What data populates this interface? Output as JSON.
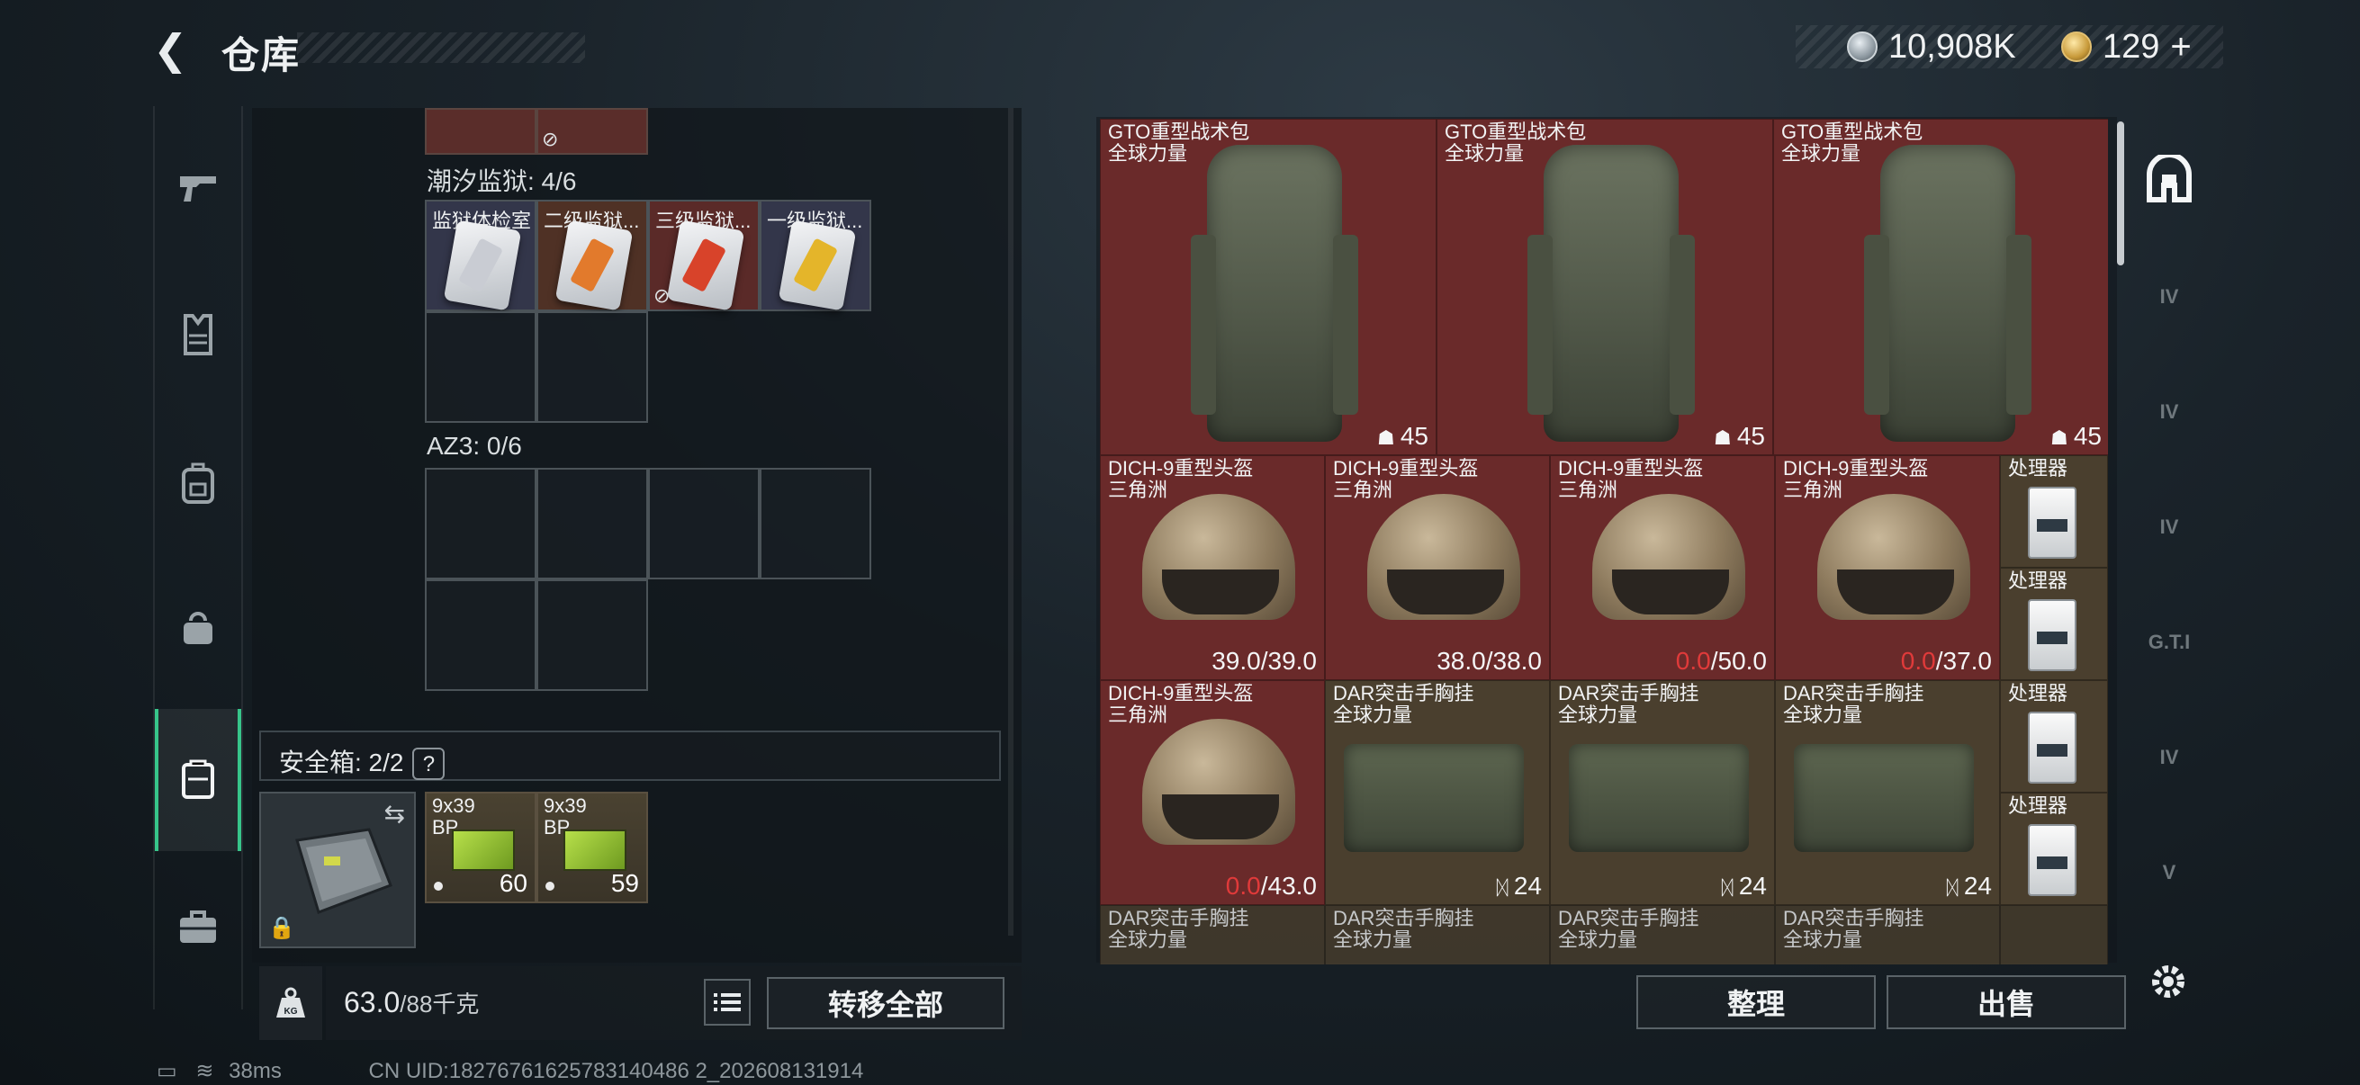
{
  "header": {
    "back_icon": "back-arrow-icon",
    "title": "仓库",
    "currency_silver": "10,908K",
    "currency_gold": "129",
    "add_label": "+"
  },
  "sidebar": {
    "items": [
      {
        "name": "weapon-icon",
        "glyph": "🔫"
      },
      {
        "name": "armor-vest-icon",
        "glyph": "🦺"
      },
      {
        "name": "backpack-icon",
        "glyph": "🎒"
      },
      {
        "name": "bag-icon",
        "glyph": "👜"
      },
      {
        "name": "safe-case-icon",
        "glyph": "🗄"
      },
      {
        "name": "toolbox-icon",
        "glyph": "🧰"
      }
    ],
    "active_index": 4
  },
  "left": {
    "section1_label": "潮汐监狱: 4/6",
    "section1_items": [
      "监狱体检室",
      "二级监狱...",
      "三级监狱...",
      "一级监狱..."
    ],
    "section2_label": "AZ3: 0/6",
    "safe_label": "安全箱: 2/2",
    "safe_help": "?",
    "ammo": [
      {
        "line1": "9x39",
        "line2": "BP",
        "count": "60"
      },
      {
        "line1": "9x39",
        "line2": "BP",
        "count": "59"
      }
    ],
    "weight_current": "63.0",
    "weight_max": "/88千克",
    "kg_icon_label": "KG",
    "transfer_all": "转移全部"
  },
  "grid": {
    "row1": [
      {
        "name": "GTO重型战术包",
        "sub": "全球力量",
        "count": "45"
      },
      {
        "name": "GTO重型战术包",
        "sub": "全球力量",
        "count": "45"
      },
      {
        "name": "GTO重型战术包",
        "sub": "全球力量",
        "count": "45"
      }
    ],
    "helmets": [
      {
        "name": "DICH-9重型头盔",
        "sub": "三角洲",
        "cur": "39.0",
        "max": "/39.0",
        "broken": false
      },
      {
        "name": "DICH-9重型头盔",
        "sub": "三角洲",
        "cur": "38.0",
        "max": "/38.0",
        "broken": false
      },
      {
        "name": "DICH-9重型头盔",
        "sub": "三角洲",
        "cur": "0.0",
        "max": "/50.0",
        "broken": true
      },
      {
        "name": "DICH-9重型头盔",
        "sub": "三角洲",
        "cur": "0.0",
        "max": "/37.0",
        "broken": true
      },
      {
        "name": "DICH-9重型头盔",
        "sub": "三角洲",
        "cur": "0.0",
        "max": "/43.0",
        "broken": true
      }
    ],
    "vests": [
      {
        "name": "DAR突击手胸挂",
        "sub": "全球力量",
        "count": "24"
      },
      {
        "name": "DAR突击手胸挂",
        "sub": "全球力量",
        "count": "24"
      },
      {
        "name": "DAR突击手胸挂",
        "sub": "全球力量",
        "count": "24"
      }
    ],
    "vests_row4": [
      {
        "name": "DAR突击手胸挂",
        "sub": "全球力量"
      },
      {
        "name": "DAR突击手胸挂",
        "sub": "全球力量"
      },
      {
        "name": "DAR突击手胸挂",
        "sub": "全球力量"
      },
      {
        "name": "DAR突击手胸挂",
        "sub": "全球力量"
      }
    ],
    "processor_label": "处理器"
  },
  "actions": {
    "organize": "整理",
    "sell": "出售"
  },
  "right_sidebar": {
    "items": [
      "IV",
      "IV",
      "IV",
      "G.T.I",
      "IV",
      "V"
    ]
  },
  "status": {
    "ping": "38ms",
    "uid": "CN UID:18276761625783140486 2_202608131914"
  },
  "colors": {
    "accent_green": "#37c58a",
    "item_red": "#6a2a2a",
    "item_olive": "#4a3f2e",
    "broken_red": "#e03a3a"
  }
}
